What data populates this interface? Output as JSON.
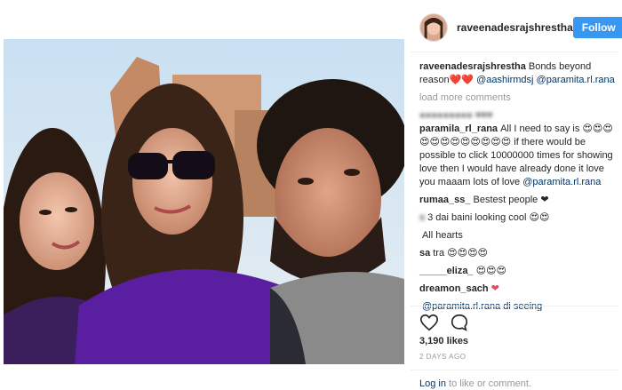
{
  "post": {
    "username": "raveenadesrajshrestha",
    "follow_label": "Follow",
    "caption_text": "Bonds beyond reason",
    "caption_hearts": "❤️❤️",
    "caption_mention1": "@aashirmdsj",
    "caption_mention2": "@paramita.rl.rana",
    "load_more": "load more comments",
    "likes": "3,190 likes",
    "time": "2 DAYS AGO",
    "login_link": "Log in",
    "login_rest": " to like or comment."
  },
  "comments": [
    {
      "user": "paramila_rl_rana",
      "text": "All I need to say is 😍😍😍😍😍😍😍😍😍😍😍😍 if there would be possible to click 10000000 times for showing love then I would have already done it love you maaam lots of love",
      "mention": "@paramita.rl.rana"
    },
    {
      "user": "rumaa_ss_",
      "text": "Bestest people ❤"
    },
    {
      "user": "s",
      "text": "3 dai baini looking cool 😍😍"
    },
    {
      "user": "",
      "text": "All hearts"
    },
    {
      "user": "sa",
      "text": "tra 😍😍😍😍"
    },
    {
      "user": "_____eliza_",
      "text": "😍😍😍"
    },
    {
      "user": "dreamon_sach",
      "text": "❤"
    },
    {
      "user": "",
      "text": "@paramita.rl.rana di seeing"
    }
  ],
  "colors": {
    "follow_bg": "#3897f0",
    "mention": "#003569",
    "heart": "#ed4956"
  },
  "icons": [
    "heart-icon",
    "comment-icon"
  ]
}
